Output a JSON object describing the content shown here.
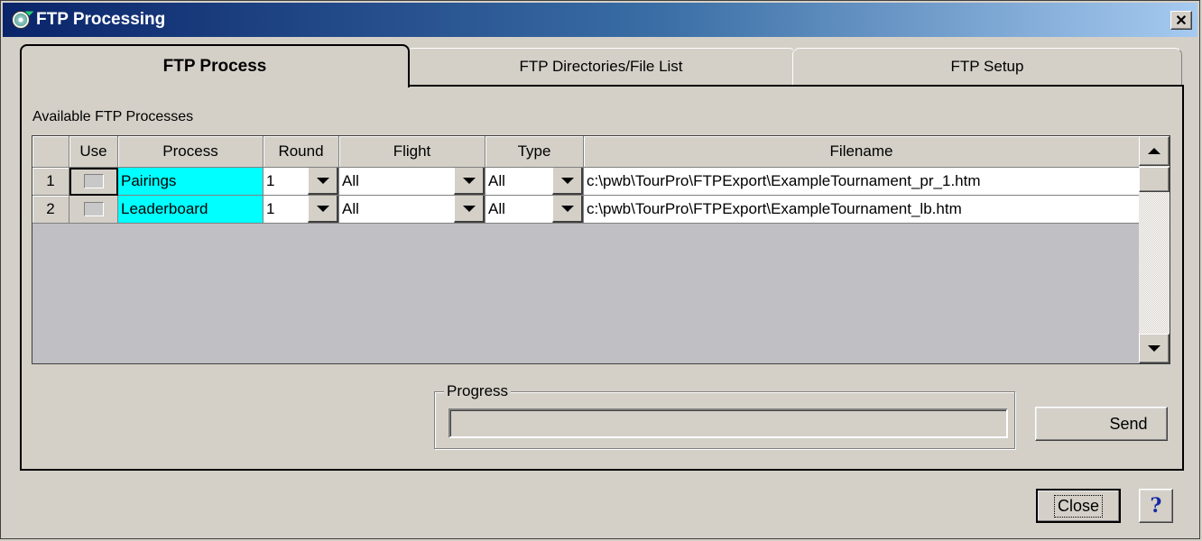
{
  "window": {
    "title": "FTP Processing",
    "close_glyph": "✕"
  },
  "tabs": [
    {
      "label": "FTP Process",
      "active": true
    },
    {
      "label": "FTP Directories/File List",
      "active": false
    },
    {
      "label": "FTP Setup",
      "active": false
    }
  ],
  "section_label": "Available FTP Processes",
  "grid": {
    "columns": [
      "Use",
      "Process",
      "Round",
      "Flight",
      "Type",
      "Filename"
    ],
    "rows": [
      {
        "num": "1",
        "use": false,
        "process": "Pairings",
        "round": "1",
        "flight": "All",
        "type": "All",
        "filename": "c:\\pwb\\TourPro\\FTPExport\\ExampleTournament_pr_1.htm"
      },
      {
        "num": "2",
        "use": false,
        "process": "Leaderboard",
        "round": "1",
        "flight": "All",
        "type": "All",
        "filename": "c:\\pwb\\TourPro\\FTPExport\\ExampleTournament_lb.htm"
      }
    ]
  },
  "progress": {
    "label": "Progress",
    "value": 0
  },
  "buttons": {
    "send": "Send",
    "close": "Close",
    "help": "?"
  },
  "icons": {
    "app": "cd-disc-icon"
  },
  "colors": {
    "title_bar": "#0a246a",
    "highlight_cell": "#00ffff",
    "face": "#d4d0c8"
  }
}
